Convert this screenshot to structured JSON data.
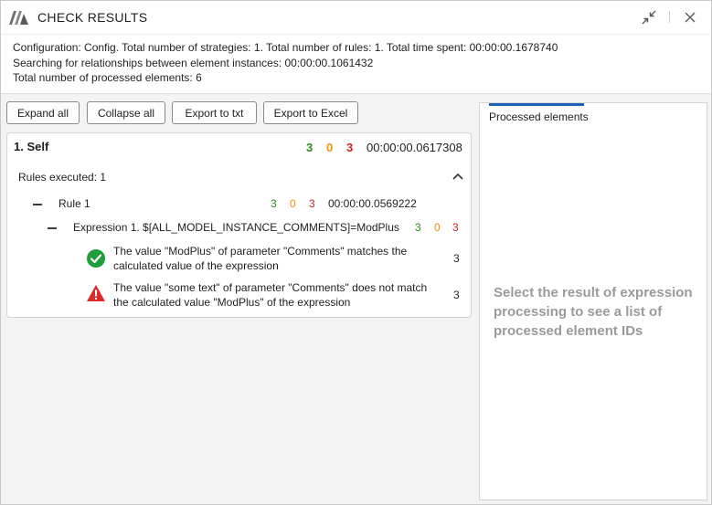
{
  "window": {
    "title": "CHECK RESULTS"
  },
  "info": {
    "line1": "Configuration: Config. Total number of strategies: 1. Total number of rules: 1. Total time spent: 00:00:00.1678740",
    "line2": "Searching for relationships between element instances: 00:00:00.1061432",
    "line3": "Total number of processed elements: 6"
  },
  "toolbar": {
    "expand_all": "Expand all",
    "collapse_all": "Collapse all",
    "export_txt": "Export to txt",
    "export_excel": "Export to Excel"
  },
  "strategy": {
    "title": "1. Self",
    "ok": "3",
    "warn": "0",
    "err": "3",
    "time": "00:00:00.0617308",
    "rules_executed": "Rules executed: 1"
  },
  "rule": {
    "name": "Rule 1",
    "ok": "3",
    "warn": "0",
    "err": "3",
    "time": "00:00:00.0569222"
  },
  "expression": {
    "label": "Expression 1. $[ALL_MODEL_INSTANCE_COMMENTS]=ModPlus",
    "ok": "3",
    "warn": "0",
    "err": "3"
  },
  "results": [
    {
      "status": "success-icon",
      "line1": "The value \"ModPlus\" of parameter \"Comments\" matches the",
      "line2": "calculated value of the expression",
      "count": "3"
    },
    {
      "status": "error-icon",
      "line1": "The value \"some text\" of parameter \"Comments\" does not match",
      "line2": "the calculated value \"ModPlus\" of the expression",
      "count": "3"
    }
  ],
  "side_panel": {
    "tab": "Processed elements",
    "hint": "Select the result of expression processing to see a list of processed element IDs"
  },
  "colors": {
    "ok": "#2e8b1e",
    "warn": "#f29100",
    "err": "#d42020",
    "accent": "#1b63b8"
  }
}
